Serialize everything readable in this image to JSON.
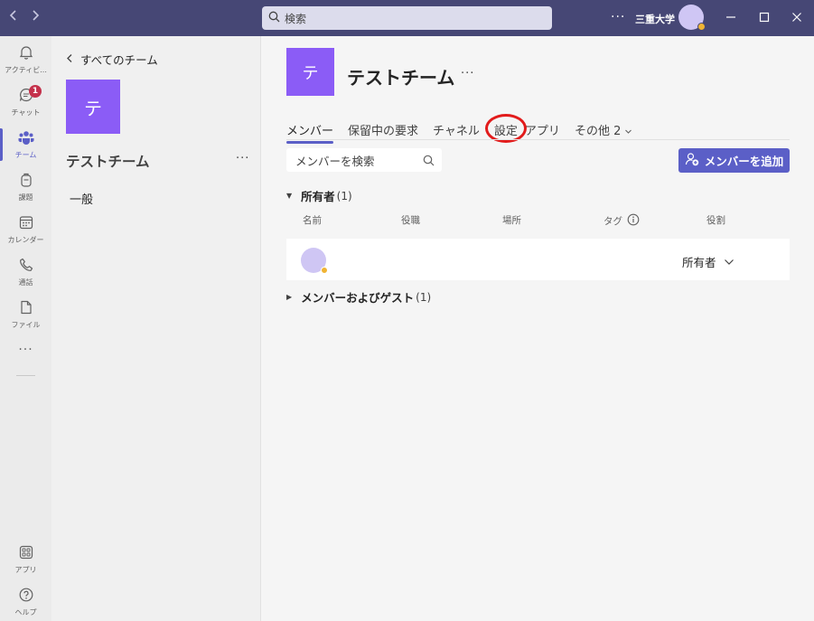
{
  "titlebar": {
    "nav_back_icon": "chevron-left",
    "nav_forward_icon": "chevron-right",
    "search_placeholder": "検索",
    "more": "···",
    "org_name": "三重大学"
  },
  "rail": {
    "items": [
      {
        "label": "アクティビ...",
        "icon": "bell-icon"
      },
      {
        "label": "チャット",
        "icon": "chat-icon",
        "badge": "1"
      },
      {
        "label": "チーム",
        "icon": "teams-icon"
      },
      {
        "label": "課題",
        "icon": "assignments-icon"
      },
      {
        "label": "カレンダー",
        "icon": "calendar-icon"
      },
      {
        "label": "通話",
        "icon": "phone-icon"
      },
      {
        "label": "ファイル",
        "icon": "file-icon"
      }
    ],
    "more": "···",
    "bottom": [
      {
        "label": "アプリ",
        "icon": "apps-icon"
      },
      {
        "label": "ヘルプ",
        "icon": "help-icon"
      }
    ]
  },
  "sidepanel": {
    "back_label": "すべてのチーム",
    "team_initial": "テ",
    "team_name": "テストチーム",
    "more": "···",
    "channels": [
      "一般"
    ]
  },
  "main": {
    "team_initial": "テ",
    "team_title": "テストチーム",
    "title_more": "···",
    "tabs": [
      "メンバー",
      "保留中の要求",
      "チャネル",
      "設定",
      "アプリ",
      "その他 2"
    ],
    "search_placeholder": "メンバーを検索",
    "add_member_label": "メンバーを追加",
    "owners_section": {
      "title": "所有者",
      "count": "(1)"
    },
    "columns": [
      "名前",
      "役職",
      "場所",
      "タグ",
      "役割"
    ],
    "owner_row": {
      "role": "所有者"
    },
    "members_section": {
      "title": "メンバーおよびゲスト",
      "count": "(1)"
    }
  },
  "colors": {
    "titlebar": "#464775",
    "accent": "#5b5fc7",
    "team_tile": "#8b5cf6",
    "highlight_ring": "#e21b1b"
  }
}
